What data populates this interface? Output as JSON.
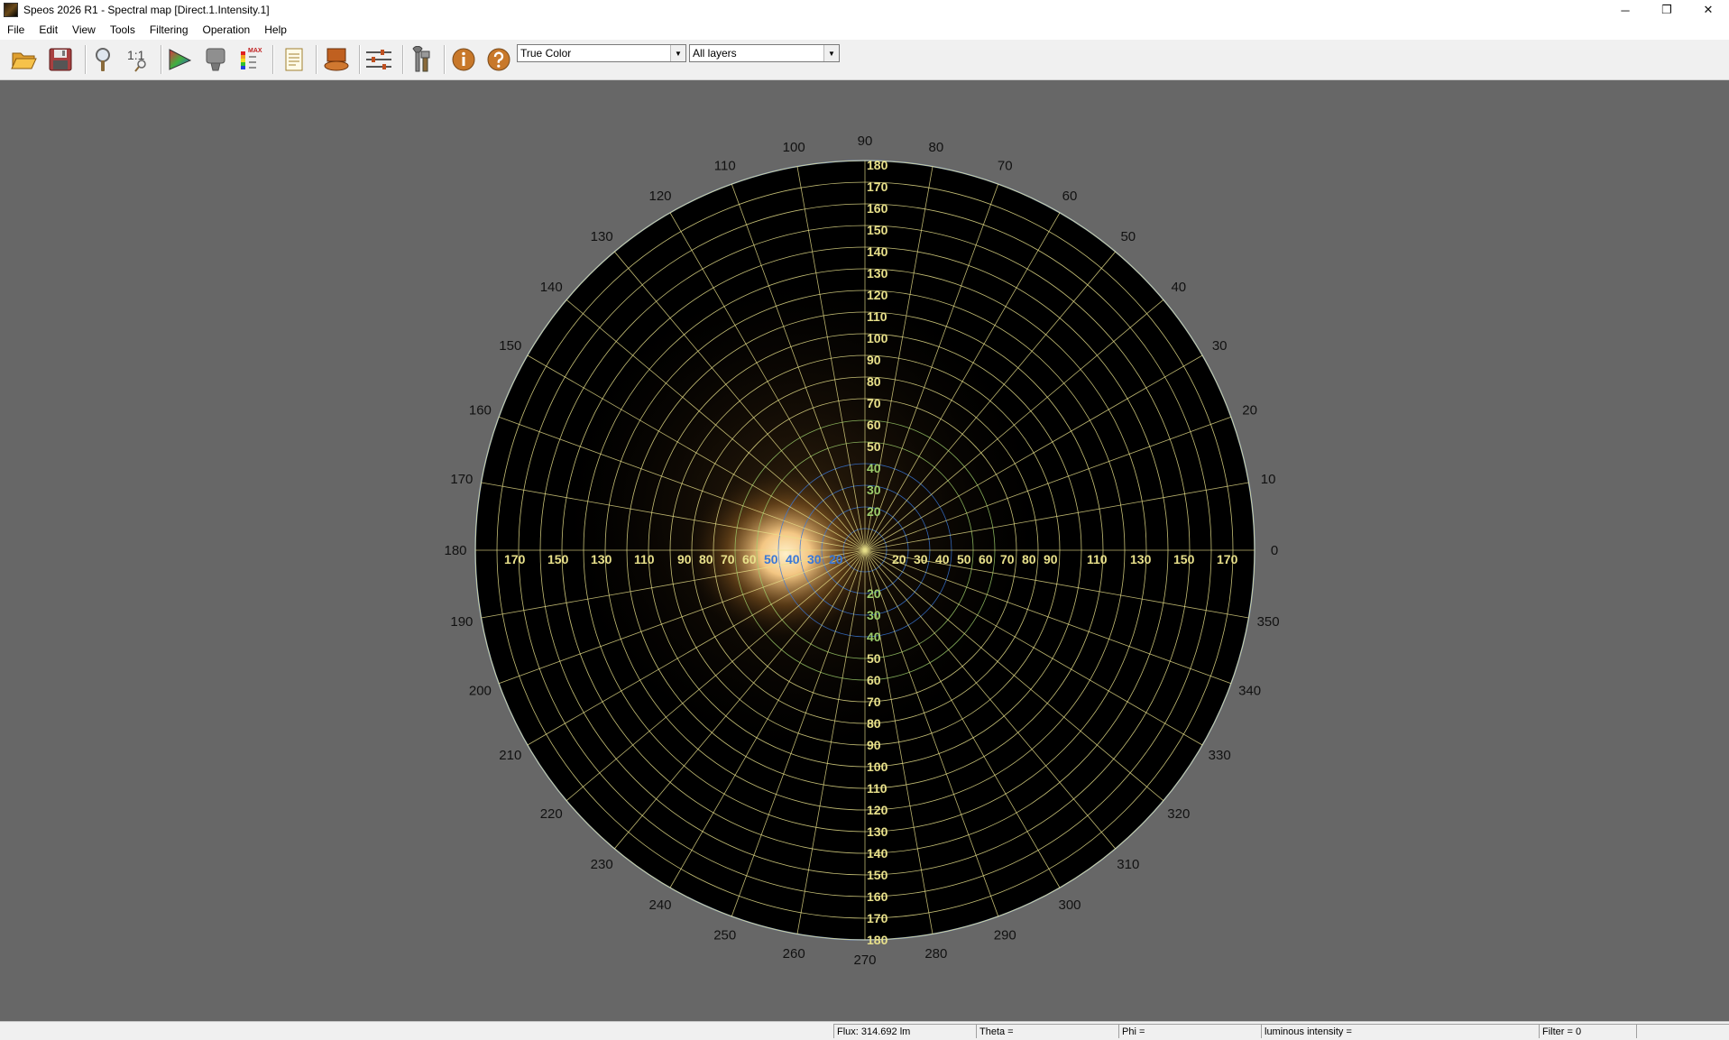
{
  "window": {
    "title": "Speos 2026 R1 - Spectral map [Direct.1.Intensity.1]",
    "minimize": "─",
    "restore": "❐",
    "close": "✕"
  },
  "menu": [
    "File",
    "Edit",
    "View",
    "Tools",
    "Filtering",
    "Operation",
    "Help"
  ],
  "toolbar": {
    "icons": [
      "open-folder-icon",
      "save-icon",
      "zoom-icon",
      "one-to-one-icon",
      "color-triangle-icon",
      "gray-shape-icon",
      "color-scale-max-icon",
      "report-icon",
      "surface-icon",
      "levels-icon",
      "tools-icon",
      "info-icon",
      "help-icon"
    ],
    "one_to_one_label": "1:1",
    "max_label": "MAX",
    "color_mode": "True Color",
    "layer": "All layers"
  },
  "polar_map": {
    "phi_labels": [
      "0",
      "10",
      "20",
      "30",
      "40",
      "50",
      "60",
      "70",
      "80",
      "90",
      "100",
      "110",
      "120",
      "130",
      "140",
      "150",
      "160",
      "170",
      "180",
      "190",
      "200",
      "210",
      "220",
      "230",
      "240",
      "250",
      "260",
      "270",
      "280",
      "290",
      "300",
      "310",
      "320",
      "330",
      "340",
      "350"
    ],
    "theta_rings": [
      10,
      20,
      30,
      40,
      50,
      60,
      70,
      80,
      90,
      100,
      110,
      120,
      130,
      140,
      150,
      160,
      170,
      180
    ],
    "vertical_axis_labels_top": [
      "180",
      "170",
      "160",
      "150",
      "140",
      "130",
      "120",
      "110",
      "100",
      "90",
      "80",
      "70",
      "60",
      "50",
      "40",
      "30",
      "20"
    ],
    "vertical_axis_labels_bottom": [
      "20",
      "30",
      "40",
      "50",
      "60",
      "70",
      "80",
      "90",
      "100",
      "110",
      "120",
      "130",
      "140",
      "150",
      "160",
      "170",
      "180"
    ],
    "horizontal_axis_labels_left": [
      "170",
      "150",
      "130",
      "110",
      "90",
      "80",
      "70",
      "60",
      "50",
      "40",
      "30",
      "20"
    ],
    "horizontal_axis_labels_right": [
      "20",
      "30",
      "40",
      "50",
      "60",
      "70",
      "80",
      "90",
      "110",
      "130",
      "150",
      "170"
    ],
    "grid_color": "#e8e08a",
    "inner_grid_color": "#3a78d8",
    "mid_grid_color": "#9ccc6a",
    "hotspot_color": "#ffd08a",
    "background": "#000000"
  },
  "status": {
    "flux": "Flux: 314.692 lm",
    "theta": "Theta =",
    "phi": "Phi =",
    "intensity": "luminous intensity =",
    "filter": "Filter = 0"
  }
}
